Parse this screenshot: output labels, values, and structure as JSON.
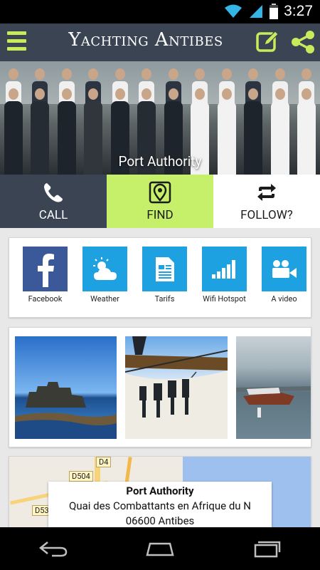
{
  "status_bar": {
    "time": "3:27"
  },
  "header": {
    "title": "Yachting Antibes"
  },
  "hero": {
    "caption": "Port Authority"
  },
  "actions": [
    {
      "label": "CALL"
    },
    {
      "label": "FIND"
    },
    {
      "label": "FOLLOW?"
    }
  ],
  "tiles": [
    {
      "label": "Facebook",
      "color": "#3b5998"
    },
    {
      "label": "Weather",
      "color": "#1ea1e0"
    },
    {
      "label": "Tarifs",
      "color": "#1ea1e0"
    },
    {
      "label": "Wifi Hotspot",
      "color": "#1ea1e0"
    },
    {
      "label": "A video",
      "color": "#1ea1e0"
    }
  ],
  "map": {
    "road_labels": [
      "D4",
      "D504",
      "D53"
    ],
    "place_name": "Port Authority",
    "address_line1": "Quai des Combattants en Afrique du N",
    "address_line2": "06600 Antibes"
  },
  "colors": {
    "header": "#3a4453",
    "accent": "#c6f06a",
    "tile_blue": "#1ea1e0"
  }
}
